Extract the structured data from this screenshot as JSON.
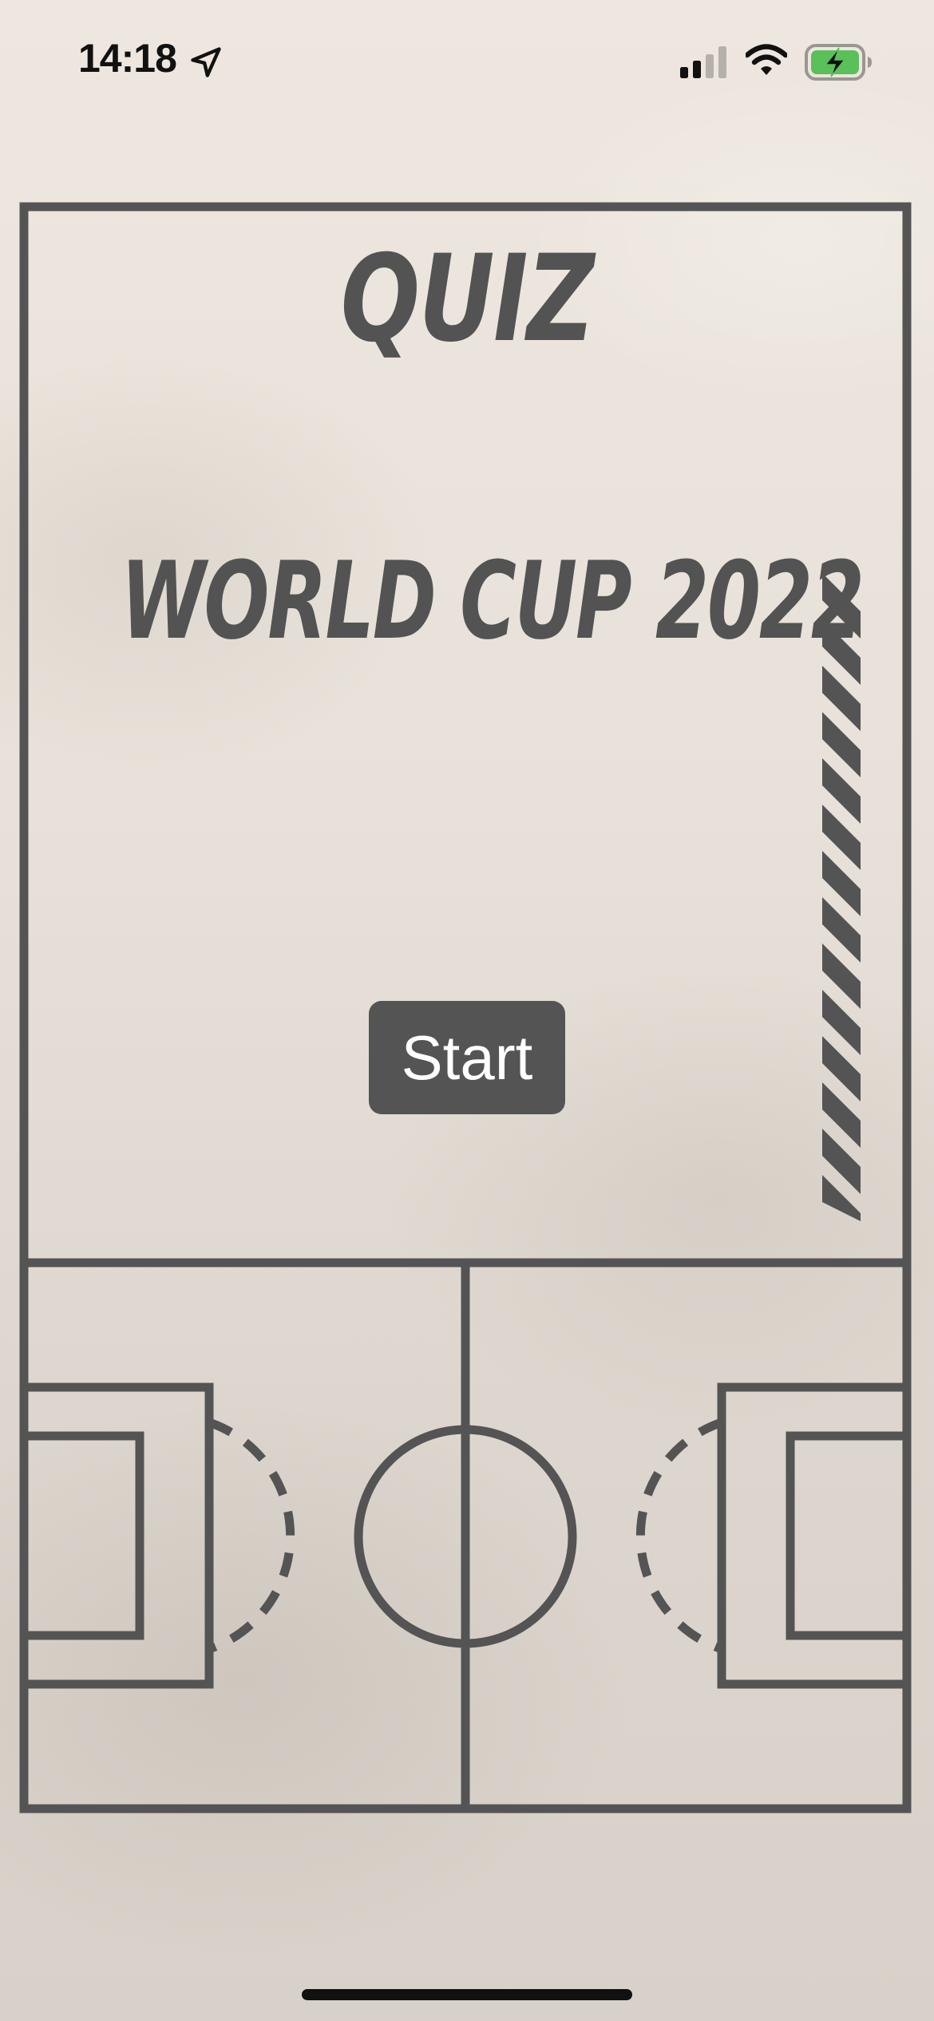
{
  "status_bar": {
    "time": "14:18",
    "icons": [
      "location-arrow-icon",
      "cellular-signal-icon",
      "wifi-icon",
      "battery-charging-icon"
    ],
    "battery_color": "#5ac05a"
  },
  "card": {
    "title": "QUIZ",
    "subtitle": "WORLD CUP 2022",
    "start_label": "Start"
  },
  "colors": {
    "ink": "#535353",
    "background": "#ebe5dd",
    "button_bg": "#545454",
    "button_text": "#ffffff"
  }
}
